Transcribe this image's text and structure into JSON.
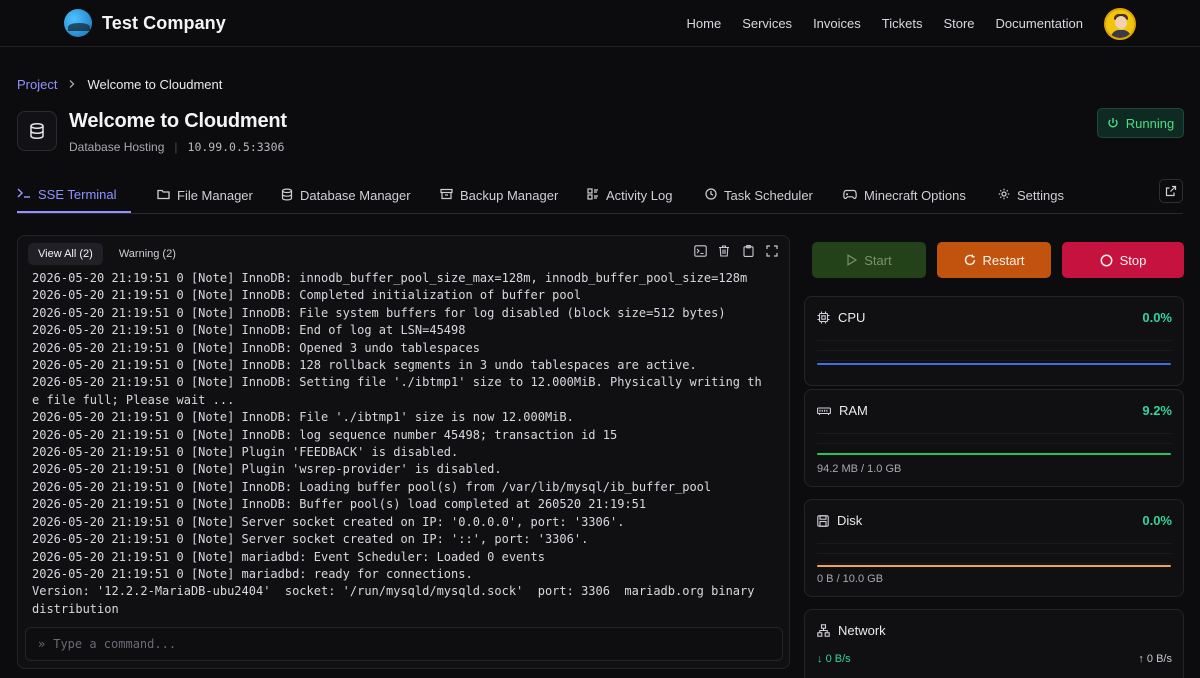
{
  "brand": {
    "name": "Test Company"
  },
  "nav": {
    "items": [
      "Home",
      "Services",
      "Invoices",
      "Tickets",
      "Store",
      "Documentation"
    ]
  },
  "breadcrumb": {
    "root": "Project",
    "current": "Welcome to Cloudment"
  },
  "header": {
    "title": "Welcome to Cloudment",
    "subtitle": "Database Hosting",
    "address": "10.99.0.5:3306",
    "status": "Running"
  },
  "tabs": [
    {
      "label": "SSE Terminal",
      "icon": "terminal-icon"
    },
    {
      "label": "File Manager",
      "icon": "folder-icon"
    },
    {
      "label": "Database Manager",
      "icon": "database-icon"
    },
    {
      "label": "Backup Manager",
      "icon": "archive-icon"
    },
    {
      "label": "Activity Log",
      "icon": "activity-icon"
    },
    {
      "label": "Task Scheduler",
      "icon": "clock-icon"
    },
    {
      "label": "Minecraft Options",
      "icon": "gamepad-icon"
    },
    {
      "label": "Settings",
      "icon": "gear-icon"
    }
  ],
  "console": {
    "filters": [
      "View All (2)",
      "Warning (2)"
    ],
    "lines": [
      "2026-05-20 21:19:51 0 [Note] InnoDB: innodb_buffer_pool_size_max=128m, innodb_buffer_pool_size=128m",
      "2026-05-20 21:19:51 0 [Note] InnoDB: Completed initialization of buffer pool",
      "2026-05-20 21:19:51 0 [Note] InnoDB: File system buffers for log disabled (block size=512 bytes)",
      "2026-05-20 21:19:51 0 [Note] InnoDB: End of log at LSN=45498",
      "2026-05-20 21:19:51 0 [Note] InnoDB: Opened 3 undo tablespaces",
      "2026-05-20 21:19:51 0 [Note] InnoDB: 128 rollback segments in 3 undo tablespaces are active.",
      "2026-05-20 21:19:51 0 [Note] InnoDB: Setting file './ibtmp1' size to 12.000MiB. Physically writing th\ne file full; Please wait ...",
      "2026-05-20 21:19:51 0 [Note] InnoDB: File './ibtmp1' size is now 12.000MiB.",
      "2026-05-20 21:19:51 0 [Note] InnoDB: log sequence number 45498; transaction id 15",
      "2026-05-20 21:19:51 0 [Note] Plugin 'FEEDBACK' is disabled.",
      "2026-05-20 21:19:51 0 [Note] Plugin 'wsrep-provider' is disabled.",
      "2026-05-20 21:19:51 0 [Note] InnoDB: Loading buffer pool(s) from /var/lib/mysql/ib_buffer_pool",
      "2026-05-20 21:19:51 0 [Note] InnoDB: Buffer pool(s) load completed at 260520 21:19:51",
      "2026-05-20 21:19:51 0 [Note] Server socket created on IP: '0.0.0.0', port: '3306'.",
      "2026-05-20 21:19:51 0 [Note] Server socket created on IP: '::', port: '3306'.",
      "2026-05-20 21:19:51 0 [Note] mariadbd: Event Scheduler: Loaded 0 events",
      "2026-05-20 21:19:51 0 [Note] mariadbd: ready for connections.",
      "Version: '12.2.2-MariaDB-ubu2404'  socket: '/run/mysqld/mysqld.sock'  port: 3306  mariadb.org binary\ndistribution"
    ],
    "input_placeholder": "Type a command...",
    "input_prompt": "»"
  },
  "power": {
    "start": "Start",
    "restart": "Restart",
    "stop": "Stop"
  },
  "stats": {
    "cpu": {
      "label": "CPU",
      "value": "0.0%",
      "color": "#3b6fe0"
    },
    "ram": {
      "label": "RAM",
      "value": "9.2%",
      "usage": "94.2 MB / 1.0 GB",
      "color": "#22c55e"
    },
    "disk": {
      "label": "Disk",
      "value": "0.0%",
      "usage": "0 B / 10.0 GB",
      "color": "#f0a060"
    },
    "network": {
      "label": "Network",
      "inbound": "0 B/s",
      "outbound": "0 B/s"
    }
  },
  "colors": {
    "accent": "#8f93ff",
    "running": "#4ade80",
    "restart": "#c2530e",
    "stop": "#c5123e",
    "start": "#23421a"
  }
}
